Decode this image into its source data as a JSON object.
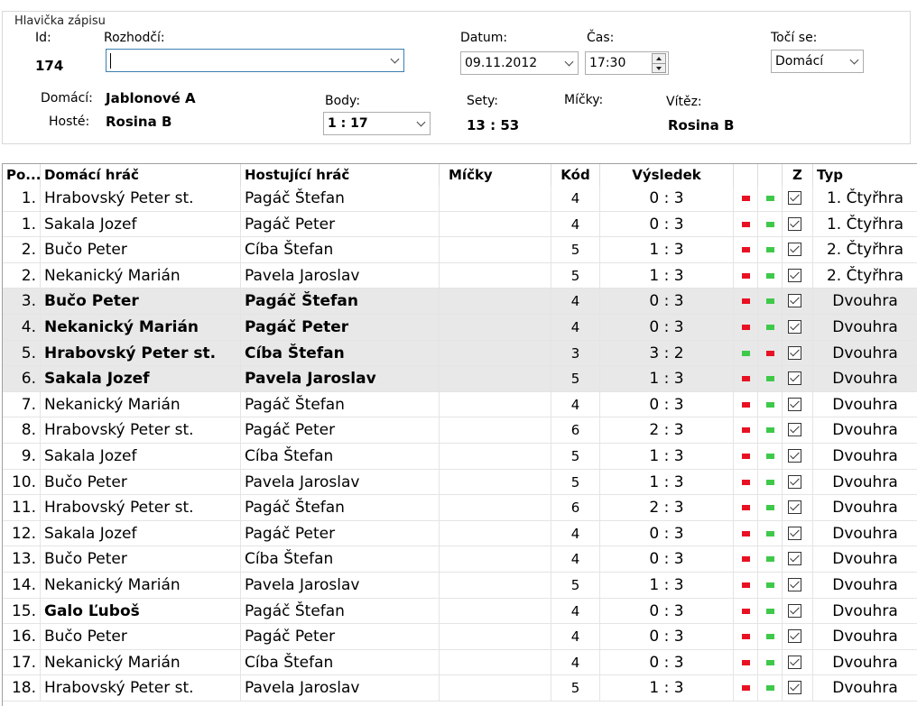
{
  "header": {
    "legend": "Hlavička zápisu",
    "id_label": "Id:",
    "id_value": "174",
    "referee_label": "Rozhodčí:",
    "referee_value": "",
    "date_label": "Datum:",
    "date_value": "09.11.2012",
    "time_label": "Čas:",
    "time_value": "17:30",
    "spin_label": "Točí se:",
    "spin_value": "Domácí",
    "home_label": "Domácí:",
    "home_value": "Jablonové A",
    "guest_label": "Hosté:",
    "guest_value": "Rosina B",
    "points_label": "Body:",
    "points_value": "1 : 17",
    "sets_label": "Sety:",
    "sets_value": "13 : 53",
    "balls_label": "Míčky:",
    "winner_label": "Vítěz:",
    "winner_value": "Rosina B"
  },
  "table": {
    "columns": {
      "order": "Po...",
      "home": "Domácí hráč",
      "guest": "Hostující hráč",
      "balls": "Míčky",
      "code": "Kód",
      "result": "Výsledek",
      "z": "Z",
      "type": "Typ"
    },
    "colors": {
      "red": "#e81123",
      "green": "#3fc94a"
    },
    "rows": [
      {
        "order": "1.",
        "home": "Hrabovský Peter st.",
        "guest": "Pagáč Štefan",
        "code": "4",
        "result": "0 : 3",
        "m1": "red",
        "m2": "green",
        "type": "1. Čtyřhra",
        "sel": false,
        "bold": false
      },
      {
        "order": "1.",
        "home": "Sakala Jozef",
        "guest": "Pagáč Peter",
        "code": "4",
        "result": "0 : 3",
        "m1": "red",
        "m2": "green",
        "type": "1. Čtyřhra",
        "sel": false,
        "bold": false
      },
      {
        "order": "2.",
        "home": "Bučo Peter",
        "guest": "Cíba Štefan",
        "code": "5",
        "result": "1 : 3",
        "m1": "red",
        "m2": "green",
        "type": "2. Čtyřhra",
        "sel": false,
        "bold": false
      },
      {
        "order": "2.",
        "home": "Nekanický Marián",
        "guest": "Pavela Jaroslav",
        "code": "5",
        "result": "1 : 3",
        "m1": "red",
        "m2": "green",
        "type": "2. Čtyřhra",
        "sel": false,
        "bold": false
      },
      {
        "order": "3.",
        "home": "Bučo Peter",
        "guest": "Pagáč Štefan",
        "code": "4",
        "result": "0 : 3",
        "m1": "red",
        "m2": "green",
        "type": "Dvouhra",
        "sel": true,
        "bold": true
      },
      {
        "order": "4.",
        "home": "Nekanický Marián",
        "guest": "Pagáč Peter",
        "code": "4",
        "result": "0 : 3",
        "m1": "red",
        "m2": "green",
        "type": "Dvouhra",
        "sel": true,
        "bold": true
      },
      {
        "order": "5.",
        "home": "Hrabovský Peter st.",
        "guest": "Cíba Štefan",
        "code": "3",
        "result": "3 : 2",
        "m1": "green",
        "m2": "red",
        "type": "Dvouhra",
        "sel": true,
        "bold": true
      },
      {
        "order": "6.",
        "home": "Sakala Jozef",
        "guest": "Pavela Jaroslav",
        "code": "5",
        "result": "1 : 3",
        "m1": "red",
        "m2": "green",
        "type": "Dvouhra",
        "sel": true,
        "bold": true
      },
      {
        "order": "7.",
        "home": "Nekanický Marián",
        "guest": "Pagáč Štefan",
        "code": "4",
        "result": "0 : 3",
        "m1": "red",
        "m2": "green",
        "type": "Dvouhra",
        "sel": false,
        "bold": false
      },
      {
        "order": "8.",
        "home": "Hrabovský Peter st.",
        "guest": "Pagáč Peter",
        "code": "6",
        "result": "2 : 3",
        "m1": "red",
        "m2": "green",
        "type": "Dvouhra",
        "sel": false,
        "bold": false
      },
      {
        "order": "9.",
        "home": "Sakala Jozef",
        "guest": "Cíba Štefan",
        "code": "5",
        "result": "1 : 3",
        "m1": "red",
        "m2": "green",
        "type": "Dvouhra",
        "sel": false,
        "bold": false
      },
      {
        "order": "10.",
        "home": "Bučo Peter",
        "guest": "Pavela Jaroslav",
        "code": "5",
        "result": "1 : 3",
        "m1": "red",
        "m2": "green",
        "type": "Dvouhra",
        "sel": false,
        "bold": false
      },
      {
        "order": "11.",
        "home": "Hrabovský Peter st.",
        "guest": "Pagáč Štefan",
        "code": "6",
        "result": "2 : 3",
        "m1": "red",
        "m2": "green",
        "type": "Dvouhra",
        "sel": false,
        "bold": false
      },
      {
        "order": "12.",
        "home": "Sakala Jozef",
        "guest": "Pagáč Peter",
        "code": "4",
        "result": "0 : 3",
        "m1": "red",
        "m2": "green",
        "type": "Dvouhra",
        "sel": false,
        "bold": false
      },
      {
        "order": "13.",
        "home": "Bučo Peter",
        "guest": "Cíba Štefan",
        "code": "4",
        "result": "0 : 3",
        "m1": "red",
        "m2": "green",
        "type": "Dvouhra",
        "sel": false,
        "bold": false
      },
      {
        "order": "14.",
        "home": "Nekanický Marián",
        "guest": "Pavela Jaroslav",
        "code": "5",
        "result": "1 : 3",
        "m1": "red",
        "m2": "green",
        "type": "Dvouhra",
        "sel": false,
        "bold": false
      },
      {
        "order": "15.",
        "home": "Galo Ľuboš",
        "guest": "Pagáč Štefan",
        "code": "4",
        "result": "0 : 3",
        "m1": "red",
        "m2": "green",
        "type": "Dvouhra",
        "sel": false,
        "bold": false,
        "home_bold": true
      },
      {
        "order": "16.",
        "home": "Bučo Peter",
        "guest": "Pagáč Peter",
        "code": "4",
        "result": "0 : 3",
        "m1": "red",
        "m2": "green",
        "type": "Dvouhra",
        "sel": false,
        "bold": false
      },
      {
        "order": "17.",
        "home": "Nekanický Marián",
        "guest": "Cíba Štefan",
        "code": "4",
        "result": "0 : 3",
        "m1": "red",
        "m2": "green",
        "type": "Dvouhra",
        "sel": false,
        "bold": false
      },
      {
        "order": "18.",
        "home": "Hrabovský Peter st.",
        "guest": "Pavela Jaroslav",
        "code": "5",
        "result": "1 : 3",
        "m1": "red",
        "m2": "green",
        "type": "Dvouhra",
        "sel": false,
        "bold": false
      }
    ]
  }
}
